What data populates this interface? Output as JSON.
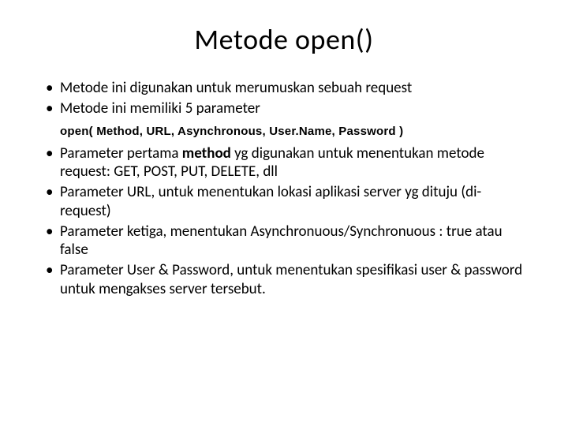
{
  "slide": {
    "title": "Metode open()",
    "bullets_top": [
      "Metode ini digunakan untuk merumuskan sebuah request",
      "Metode ini memiliki 5 parameter"
    ],
    "code_line": "open( Method, URL, Asynchronous, User.Name, Password )",
    "bullet3_prefix": "Parameter pertama ",
    "bullet3_bold": "method",
    "bullet3_suffix": " yg digunakan untuk menentukan metode request: GET, POST, PUT, DELETE, dll",
    "bullets_rest": [
      "Parameter URL, untuk menentukan lokasi aplikasi server yg dituju (di-request)",
      "Parameter ketiga, menentukan Asynchronuous/Synchronuous : true atau false",
      "Parameter User & Password, untuk menentukan spesifikasi user & password untuk mengakses server tersebut."
    ]
  }
}
